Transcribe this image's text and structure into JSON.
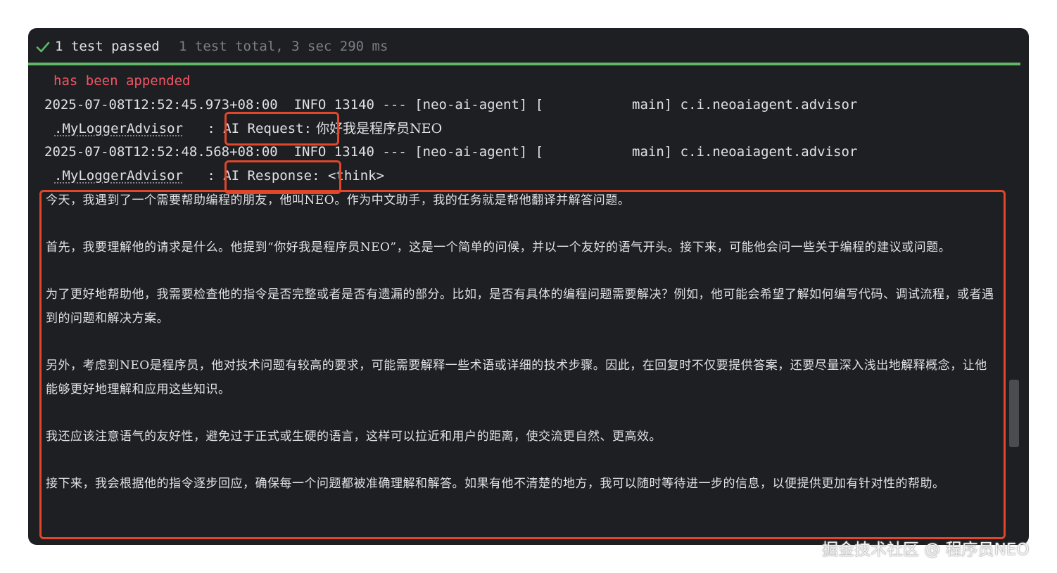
{
  "header": {
    "status": "1 test passed",
    "summary": "1 test total, 3 sec 290 ms"
  },
  "console": {
    "appended_text": "has been appended",
    "log1_line1": "2025-07-08T12:52:45.973+08:00  INFO 13140 --- [neo-ai-agent] [           main] c.i.neoaiagent.advisor",
    "log1_class": ".MyLoggerAdvisor",
    "log1_sep": "   : ",
    "log1_label": "AI Request:",
    "log1_msg": " 你好我是程序员NEO",
    "log2_line1": "2025-07-08T12:52:48.568+08:00  INFO 13140 --- [neo-ai-agent] [           main] c.i.neoaiagent.advisor",
    "log2_class": ".MyLoggerAdvisor",
    "log2_sep": "   : ",
    "log2_label": "AI Response:",
    "log2_msg": " <think>",
    "paragraphs": [
      "今天，我遇到了一个需要帮助编程的朋友，他叫NEO。作为中文助手，我的任务就是帮他翻译并解答问题。",
      "首先，我要理解他的请求是什么。他提到“你好我是程序员NEO”，这是一个简单的问候，并以一个友好的语气开头。接下来，可能他会问一些关于编程的建议或问题。",
      "为了更好地帮助他，我需要检查他的指令是否完整或者是否有遗漏的部分。比如，是否有具体的编程问题需要解决？例如，他可能会希望了解如何编写代码、调试流程，或者遇到的问题和解决方案。",
      "另外，考虑到NEO是程序员，他对技术问题有较高的要求，可能需要解释一些术语或详细的技术步骤。因此，在回复时不仅要提供答案，还要尽量深入浅出地解释概念，让他能够更好地理解和应用这些知识。",
      "我还应该注意语气的友好性，避免过于正式或生硬的语言，这样可以拉近和用户的距离，使交流更自然、更高效。",
      "接下来，我会根据他的指令逐步回应，确保每一个问题都被准确理解和解答。如果有他不清楚的地方，我可以随时等待进一步的信息，以便提供更加有针对性的帮助。"
    ]
  },
  "watermark": "掘金技术社区 @ 程序员NEO",
  "colors": {
    "background": "#1e1f22",
    "pass_green": "#5fb865",
    "error_red": "#f75464",
    "highlight_box": "#e1452a"
  }
}
